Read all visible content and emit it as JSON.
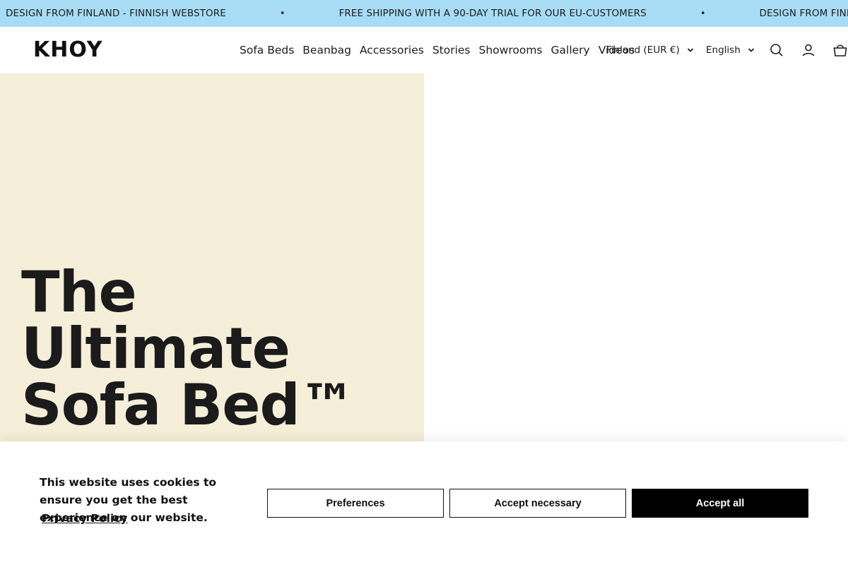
{
  "announcement": {
    "messages": [
      "DESIGN FROM FINLAND - FINNISH WEBSTORE",
      "FREE SHIPPING WITH A 90-DAY TRIAL FOR OUR EU-CUSTOMERS",
      "DESIGN FROM FINLAND - FINNISH WEBSTORE"
    ],
    "separator": "•",
    "background": "#a8dcf5"
  },
  "header": {
    "logo": "KHOY",
    "nav": [
      "Sofa Beds",
      "Beanbag",
      "Accessories",
      "Stories",
      "Showrooms",
      "Gallery",
      "Videos"
    ],
    "country_selector": "Finland (EUR €)",
    "language_selector": "English",
    "icons": [
      "search-icon",
      "account-icon",
      "cart-icon"
    ]
  },
  "hero": {
    "title_lines": [
      "The",
      "Ultimate",
      "Sofa Bed™"
    ],
    "background": "#f5efd9"
  },
  "cookie_banner": {
    "text": "This website uses cookies to ensure you get the best experience on our website.",
    "link": "Privacy Policy",
    "buttons": {
      "preferences": "Preferences",
      "accept_necessary": "Accept necessary",
      "accept_all": "Accept all"
    }
  }
}
